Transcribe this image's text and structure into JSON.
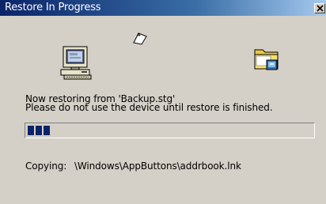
{
  "window": {
    "title": "Restore In Progress"
  },
  "animation": {
    "source_icon": "computer-icon",
    "paper_icon": "flying-paper-icon",
    "destination_icon": "folder-icon"
  },
  "message": {
    "line1": "Now restoring from 'Backup.stg'",
    "line2": "Please do not use the device until restore is finished."
  },
  "progress": {
    "filled_blocks": 3,
    "fraction": 0.07
  },
  "copying": {
    "label": "Copying:",
    "path": "\\Windows\\AppButtons\\addrbook.lnk"
  },
  "colors": {
    "title_start": "#0a246a",
    "title_end": "#a6caf0",
    "face": "#d4d0c8",
    "progress_fill": "#0a246a"
  }
}
